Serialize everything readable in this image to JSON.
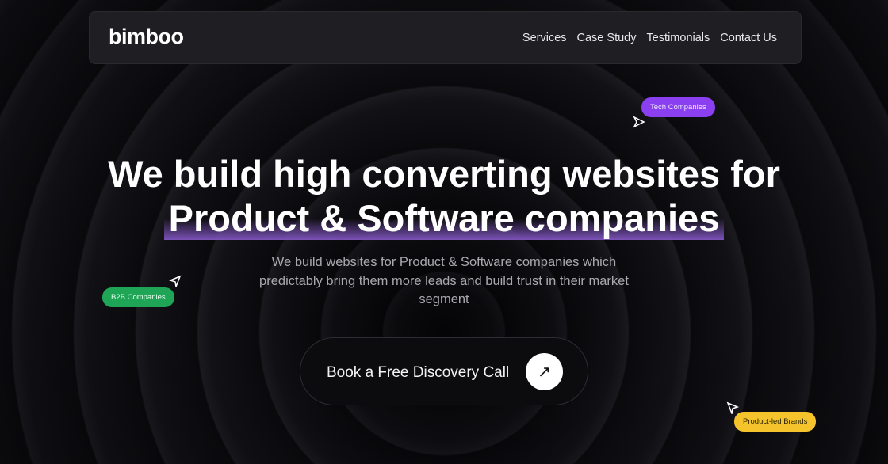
{
  "nav": {
    "logo": "bimboo",
    "links": [
      "Services",
      "Case Study",
      "Testimonials",
      "Contact Us"
    ]
  },
  "hero": {
    "line1": "We build high converting websites for",
    "line2": "Product & Software companies",
    "subtitle": "We build websites for Product & Software companies which predictably bring them more leads and build trust in their market segment",
    "cta": "Book a Free Discovery Call"
  },
  "tags": {
    "tech": "Tech Companies",
    "b2b": "B2B Companies",
    "product": "Product-led Brands"
  },
  "colors": {
    "tech": "#8a3ff0",
    "b2b": "#1fa556",
    "product": "#f5c42c",
    "highlight": "#7b52b8"
  }
}
